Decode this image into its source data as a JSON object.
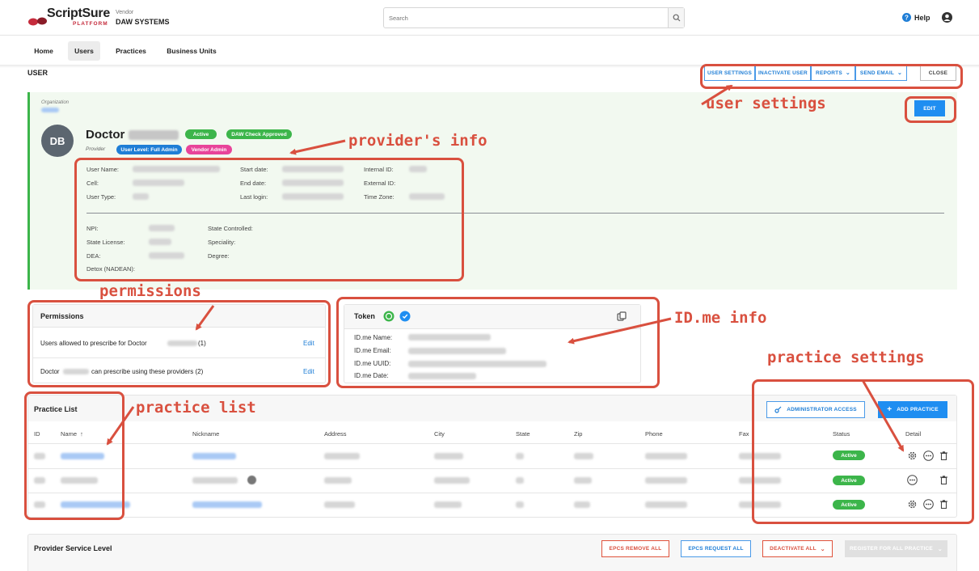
{
  "brand": {
    "name": "ScriptSure",
    "sub": "PLATFORM"
  },
  "vendor": {
    "label": "Vendor",
    "name": "DAW SYSTEMS"
  },
  "search": {
    "placeholder": "Search"
  },
  "header": {
    "help": "Help"
  },
  "nav": {
    "items": [
      "Home",
      "Users",
      "Practices",
      "Business Units"
    ],
    "active": "Users"
  },
  "page": {
    "title": "USER"
  },
  "toolbar": {
    "user_settings": "USER SETTINGS",
    "inactivate_user": "INACTIVATE USER",
    "reports": "REPORTS",
    "send_email": "SEND EMAIL",
    "close": "CLOSE",
    "edit": "EDIT"
  },
  "profile": {
    "org_label": "Organization",
    "initials": "DB",
    "first_name": "Doctor",
    "role": "Provider",
    "badges": {
      "active": "Active",
      "daw_check": "DAW Check Approved",
      "user_level": "User Level: Full Admin",
      "vendor_admin": "Vendor Admin"
    },
    "fields": {
      "user_name": "User Name:",
      "cell": "Cell:",
      "user_type": "User Type:",
      "start_date": "Start date:",
      "end_date": "End date:",
      "last_login": "Last login:",
      "internal_id": "Internal ID:",
      "external_id": "External ID:",
      "time_zone": "Time Zone:",
      "npi": "NPI:",
      "state_license": "State License:",
      "dea": "DEA:",
      "detox": "Detox (NADEAN):",
      "state_controlled": "State Controlled:",
      "speciality": "Speciality:",
      "degree": "Degree:"
    }
  },
  "permissions": {
    "title": "Permissions",
    "row1": "Users allowed to prescribe for Doctor",
    "row1_count": "(1)",
    "row2_prefix": "Doctor",
    "row2": "can prescribe using these providers (2)",
    "edit": "Edit"
  },
  "token": {
    "title": "Token",
    "name": "ID.me Name:",
    "email": "ID.me Email:",
    "uuid": "ID.me UUID:",
    "date": "ID.me Date:"
  },
  "practice_list": {
    "title": "Practice List",
    "admin_access": "ADMINISTRATOR ACCESS",
    "add_practice": "ADD PRACTICE",
    "columns": [
      "ID",
      "Name",
      "Nickname",
      "Address",
      "City",
      "State",
      "Zip",
      "Phone",
      "Fax",
      "Status",
      "Detail"
    ],
    "rows": [
      {
        "status": "Active"
      },
      {
        "status": "Active"
      },
      {
        "status": "Active"
      }
    ]
  },
  "service_level": {
    "title": "Provider Service Level",
    "epcs_remove": "EPCS REMOVE ALL",
    "epcs_request": "EPCS REQUEST ALL",
    "deactivate": "DEACTIVATE ALL",
    "register": "REGISTER FOR ALL PRACTICE"
  },
  "annotations": {
    "user_settings": "user settings",
    "providers_info": "provider's info",
    "permissions": "permissions",
    "idme_info": "ID.me info",
    "practice_settings": "practice settings",
    "practice_list": "practice list"
  },
  "colors": {
    "accent": "#1f7ed6",
    "active_green": "#3cb54a",
    "annotation": "#d9503f",
    "user_level": "#1f7ed6",
    "vendor_admin": "#e8449a"
  }
}
